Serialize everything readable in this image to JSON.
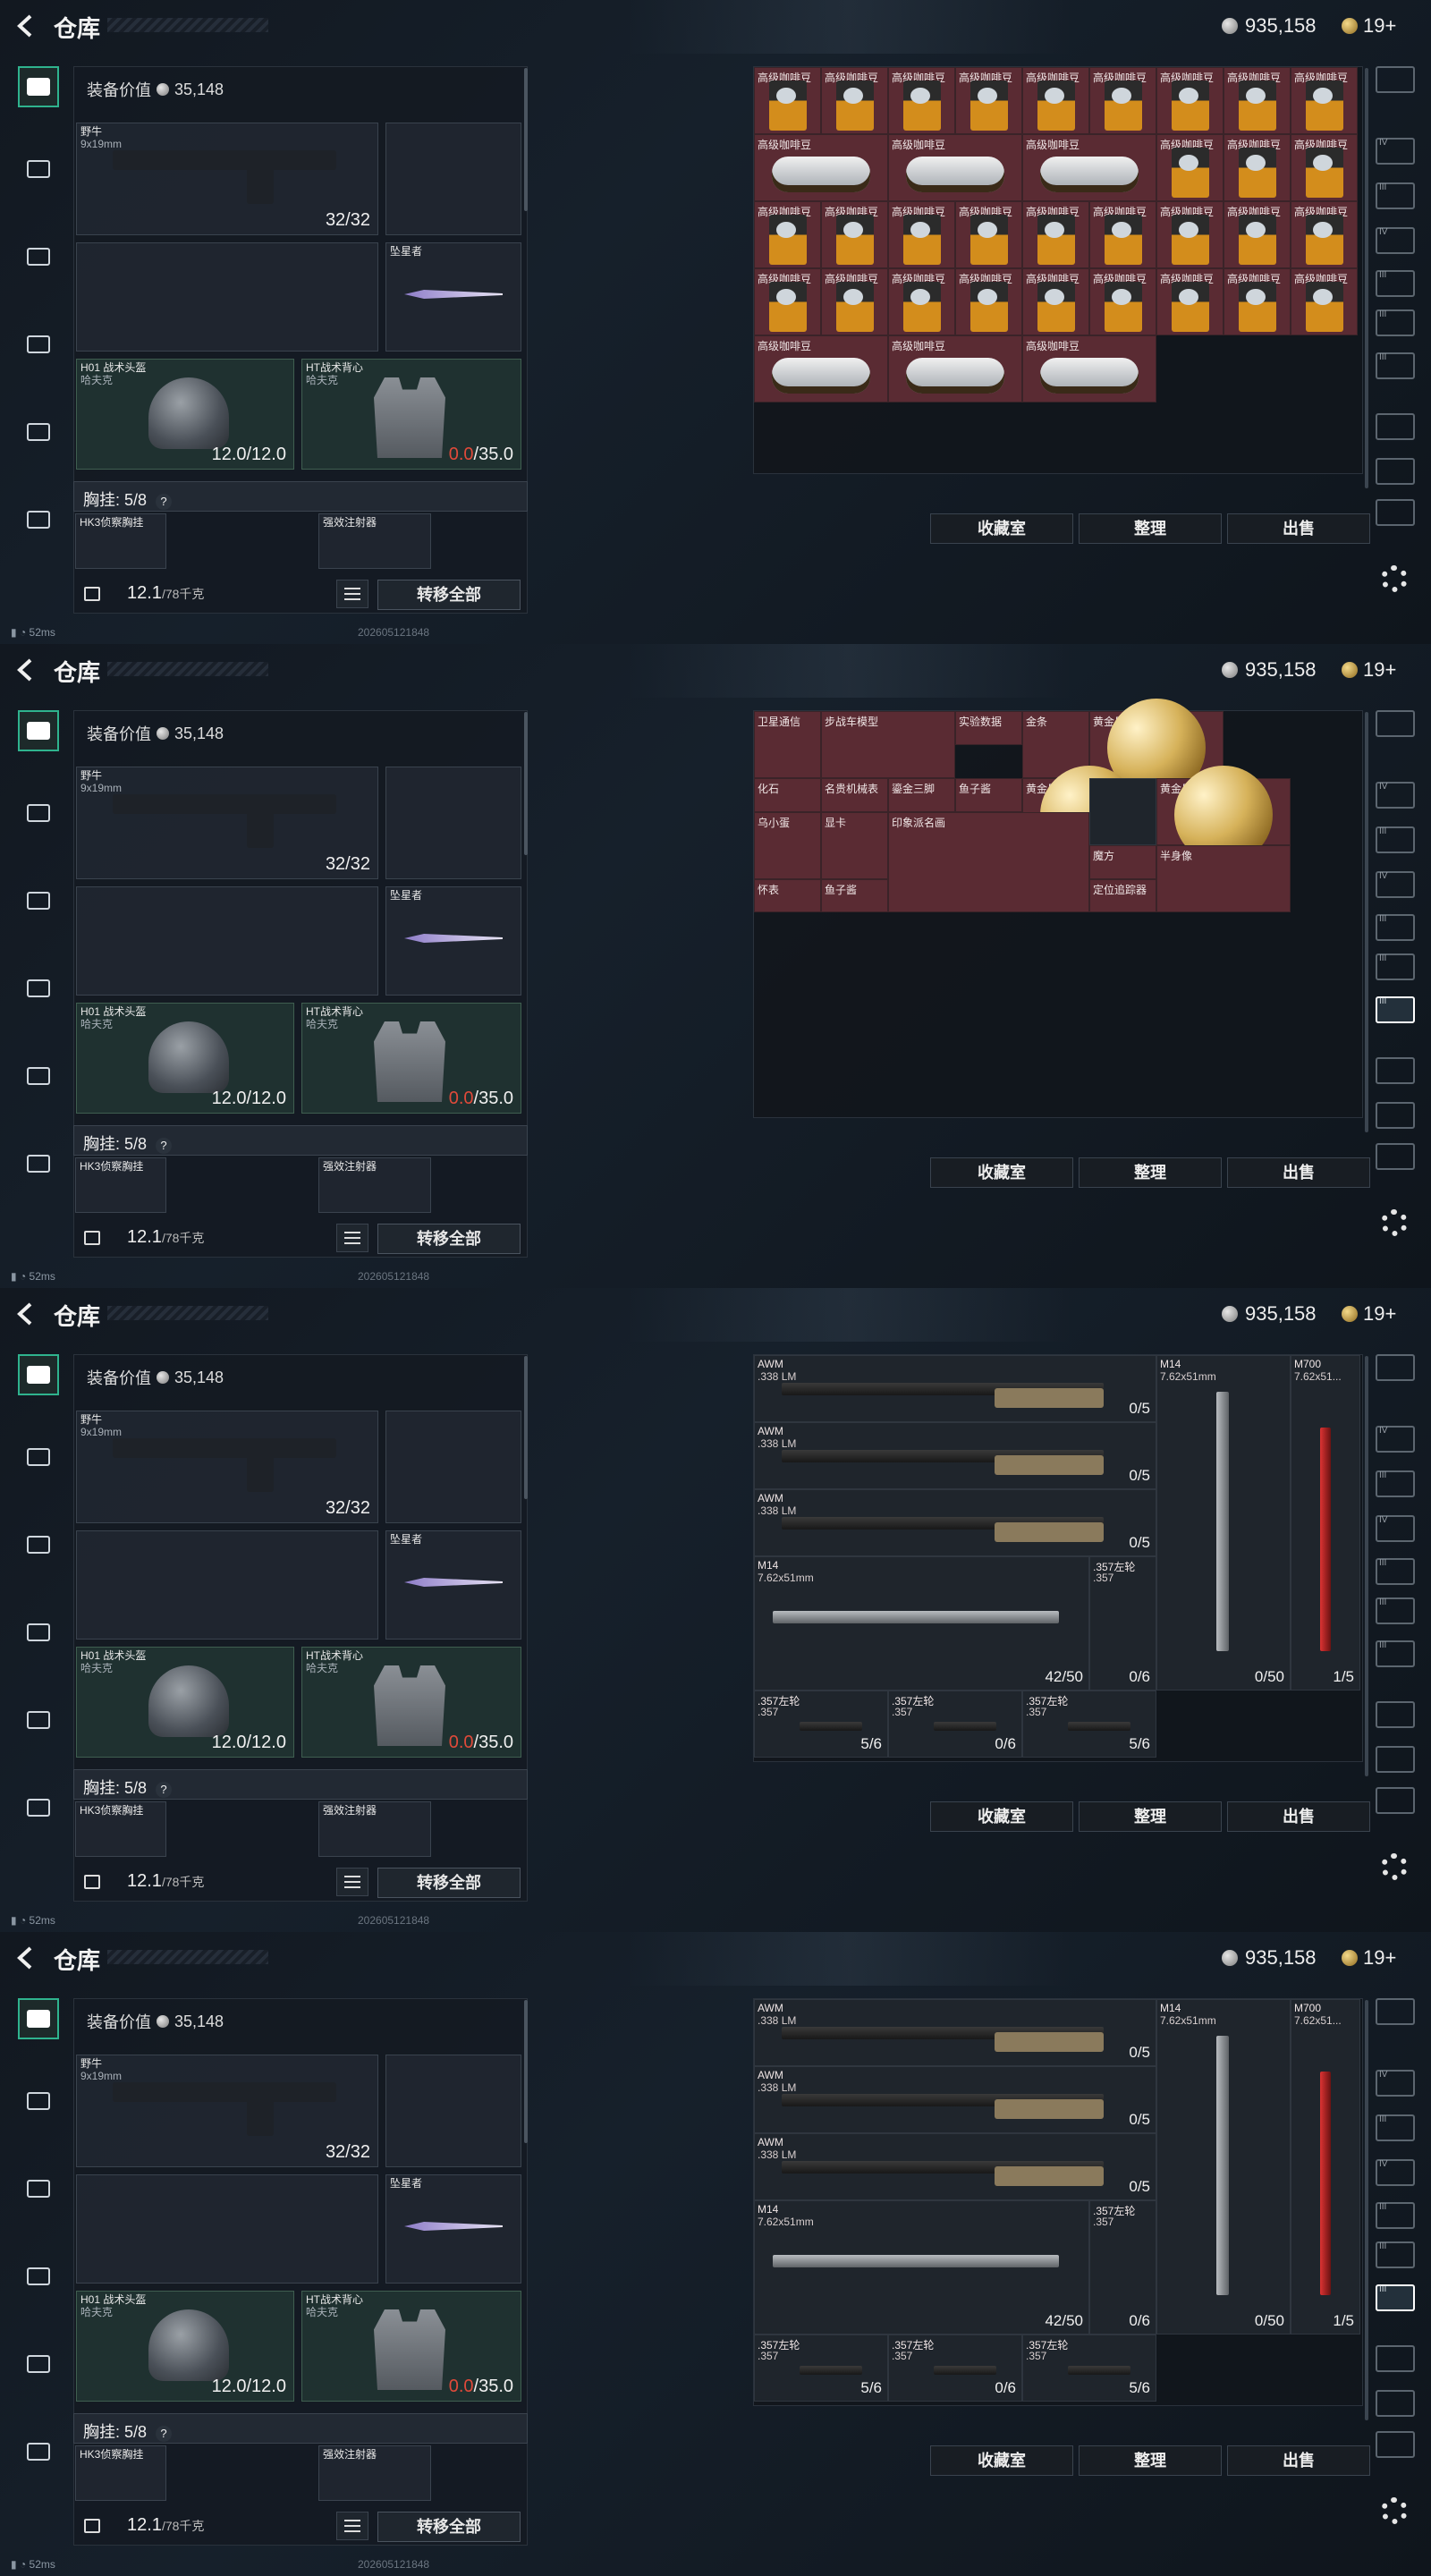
{
  "common": {
    "title": "仓库",
    "currency_silver": "935,158",
    "currency_gold": "19+",
    "equip_value_label": "装备价值",
    "equip_value": "35,148",
    "primary_name": "野牛",
    "primary_ammo": "9x19mm",
    "primary_count": "32/32",
    "knife_name": "坠星者",
    "helmet_name": "H01 战术头盔",
    "helmet_sub": "哈夫克",
    "helmet_durability": "12.0/12.0",
    "vest_name": "HT战术背心",
    "vest_sub": "哈夫克",
    "vest_durability_cur": "0.0",
    "vest_durability_max": "/35.0",
    "chest_label": "胸挂: 5/8",
    "chest_help": "?",
    "chest_item1": "HK3侦察胸挂",
    "chest_item2": "强效注射器",
    "weight": "12.1",
    "weight_max": "/78千克",
    "transfer_all": "转移全部",
    "btn_collection": "收藏室",
    "btn_sort": "整理",
    "btn_sell": "出售",
    "ping": "52ms",
    "build_stamp": "202605121848"
  },
  "panels": [
    {
      "grid_type": "coffee",
      "cells": [
        {
          "label": "高级咖啡豆"
        },
        {
          "label": "高级咖啡豆"
        },
        {
          "label": "高级咖啡豆"
        },
        {
          "label": "高级咖啡豆"
        },
        {
          "label": "高级咖啡豆"
        },
        {
          "label": "高级咖啡豆"
        },
        {
          "label": "高级咖啡豆"
        },
        {
          "label": "高级咖啡豆"
        },
        {
          "label": "高级咖啡豆"
        }
      ],
      "bag_labels": [
        "高级咖啡豆",
        "高级咖啡豆",
        "高级咖啡豆"
      ]
    },
    {
      "grid_type": "valuables",
      "items": [
        {
          "label": "卫星通信"
        },
        {
          "label": "步战车模型"
        },
        {
          "label": "实验数据"
        },
        {
          "label": "金条"
        },
        {
          "label": "黄金足球"
        },
        {
          "label": "化石"
        },
        {
          "label": "名贵机械表"
        },
        {
          "label": "鎏金三脚"
        },
        {
          "label": "鱼子酱"
        },
        {
          "label": "黄金足球"
        },
        {
          "label": "黄金足球"
        },
        {
          "label": "乌小蛋"
        },
        {
          "label": "显卡"
        },
        {
          "label": "印象派名画"
        },
        {
          "label": "魔方"
        },
        {
          "label": "半身像"
        },
        {
          "label": "怀表"
        },
        {
          "label": "鱼子酱"
        },
        {
          "label": "定位追踪器"
        }
      ]
    },
    {
      "grid_type": "rifles",
      "rows": [
        {
          "name": "AWM",
          "ammo": ".338 LM",
          "count": "0/5"
        },
        {
          "name": "AWM",
          "ammo": ".338 LM",
          "count": "0/5"
        },
        {
          "name": "AWM",
          "ammo": ".338 LM",
          "count": "0/5"
        }
      ],
      "m14_big": {
        "name": "M14",
        "ammo": "7.62x51mm",
        "count": "42/50"
      },
      "m14_tall": {
        "name": "M14",
        "ammo": "7.62x51mm",
        "count": "0/50"
      },
      "m700": {
        "name": "M700",
        "ammo": "7.62x51...",
        "count": "1/5"
      },
      "rev_tall": {
        "name": ".357左轮",
        "ammo": ".357",
        "count": "0/6"
      },
      "revolvers": [
        {
          "name": ".357左轮",
          "ammo": ".357",
          "count": "5/6"
        },
        {
          "name": ".357左轮",
          "ammo": ".357",
          "count": "0/6"
        },
        {
          "name": ".357左轮",
          "ammo": ".357",
          "count": "5/6"
        }
      ]
    },
    {
      "grid_type": "rifles",
      "rows": [
        {
          "name": "AWM",
          "ammo": ".338 LM",
          "count": "0/5"
        },
        {
          "name": "AWM",
          "ammo": ".338 LM",
          "count": "0/5"
        },
        {
          "name": "AWM",
          "ammo": ".338 LM",
          "count": "0/5"
        }
      ],
      "m14_big": {
        "name": "M14",
        "ammo": "7.62x51mm",
        "count": "42/50"
      },
      "m14_tall": {
        "name": "M14",
        "ammo": "7.62x51mm",
        "count": "0/50"
      },
      "m700": {
        "name": "M700",
        "ammo": "7.62x51...",
        "count": "1/5"
      },
      "rev_tall": {
        "name": ".357左轮",
        "ammo": ".357",
        "count": "0/6"
      },
      "revolvers": [
        {
          "name": ".357左轮",
          "ammo": ".357",
          "count": "5/6"
        },
        {
          "name": ".357左轮",
          "ammo": ".357",
          "count": "0/6"
        },
        {
          "name": ".357左轮",
          "ammo": ".357",
          "count": "5/6"
        }
      ]
    }
  ],
  "right_nav_labels": [
    "IV",
    "III",
    "IV",
    "III",
    "III",
    "III"
  ],
  "colors": {
    "accent": "#2fb38e",
    "cell_red": "#5a2b33",
    "durability_low": "#e04a3a"
  }
}
